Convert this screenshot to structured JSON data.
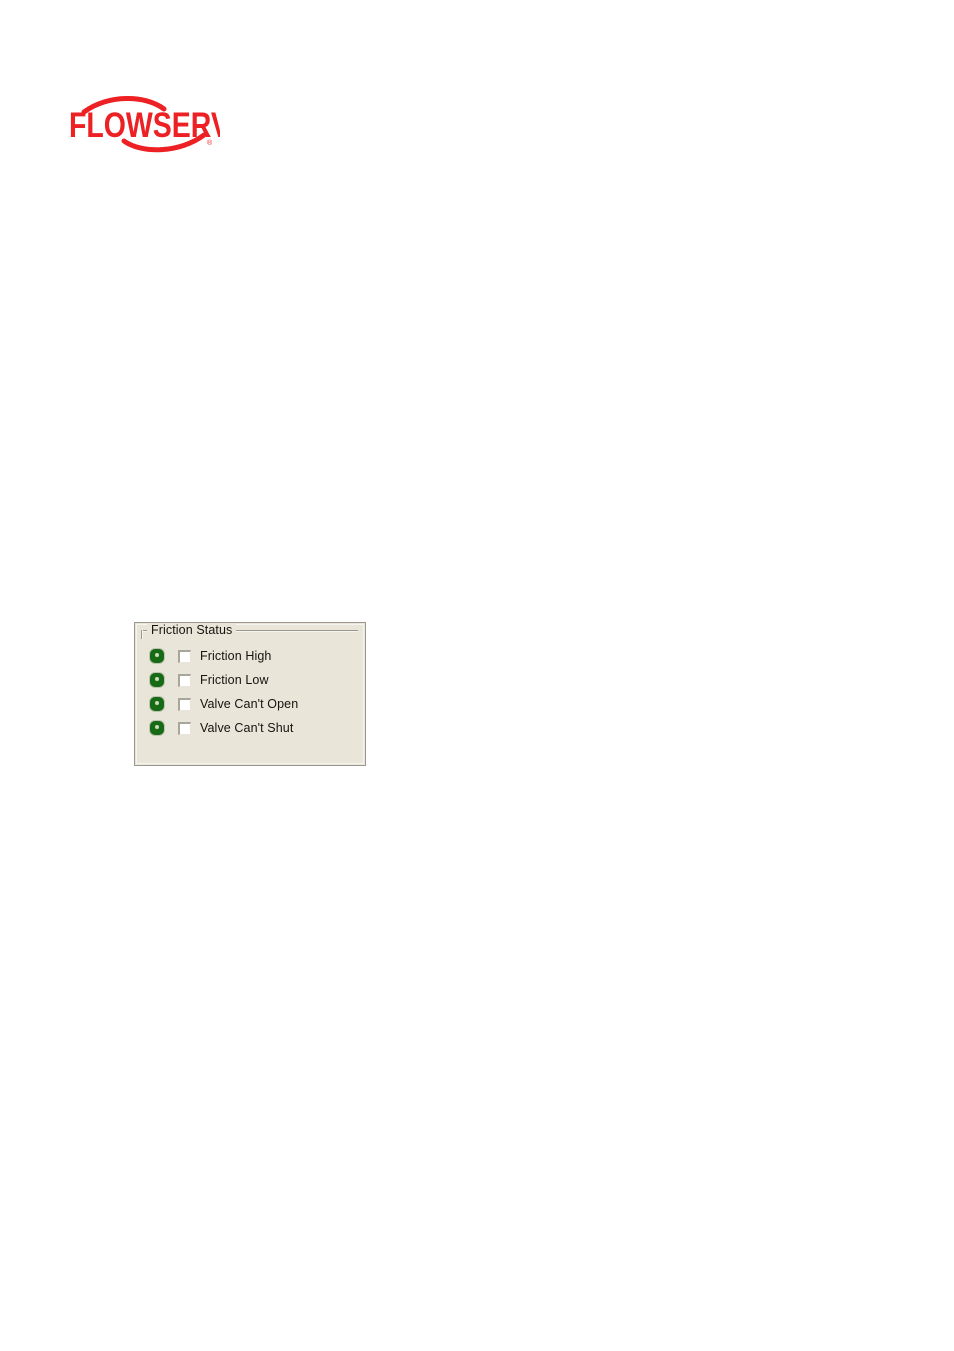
{
  "page": {
    "background_color": "#ffffff"
  },
  "logo": {
    "name": "flowserve-logo",
    "wordmark": "FLOWSERVE",
    "trademark": "®",
    "color": "#ED2024"
  },
  "friction_status_panel": {
    "title": "Friction Status",
    "background_color": "#e9e5d9",
    "border_color": "#9a988e",
    "led_color": "#176b17",
    "led_core_color": "#c9ddbd",
    "rows": [
      {
        "led_state": "green",
        "checked": false,
        "label": "Friction High"
      },
      {
        "led_state": "green",
        "checked": false,
        "label": "Friction Low"
      },
      {
        "led_state": "green",
        "checked": false,
        "label": "Valve Can't Open"
      },
      {
        "led_state": "green",
        "checked": false,
        "label": "Valve Can't Shut"
      }
    ]
  }
}
